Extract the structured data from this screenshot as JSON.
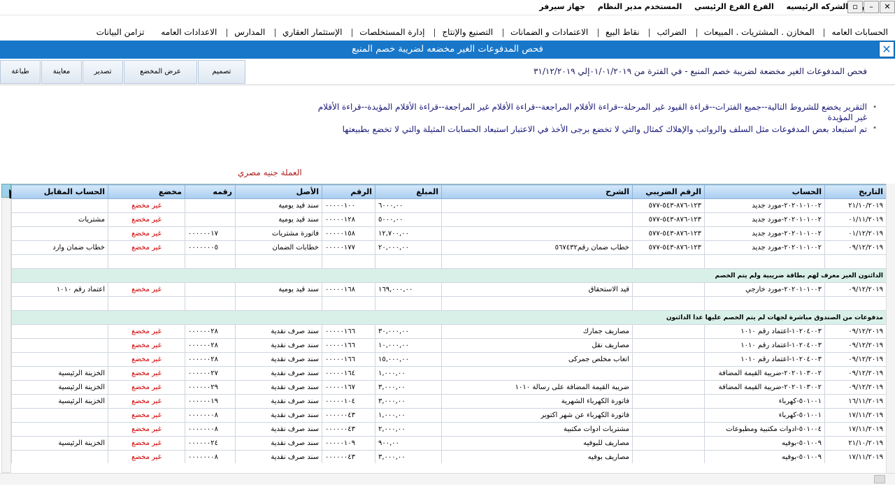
{
  "titlebar": {
    "company": "الشركة الشركه الرئيسيه",
    "branch": "الفرع الفرع الرئيسي",
    "user": "المستخدم مدير النظام",
    "device": "جهاز سيرفر",
    "buttons": [
      "▫",
      "–",
      "✕"
    ]
  },
  "menu": [
    "الحسابات العامه",
    "المخازن . المشتريات . المبيعات",
    "الضرائب",
    "نقاط البيع",
    "الاعتمادات و الضمانات",
    "التصنيع والإنتاج",
    "إدارة المستخلصات",
    "الإستثمار العقاري",
    "المدارس",
    "الاعدادات العامه",
    "تزامن البيانات"
  ],
  "form": {
    "title": "فحص المدفوعات الغير مخضعه لضريبة خصم المنبع",
    "close": "✕"
  },
  "toolbar": [
    "تصميم",
    "عرض المخضع",
    "تصدير",
    "معاينة",
    "طباعة"
  ],
  "report_title": "فحص المدفوعات الغير مخضعة لضريبة خصم المنبع -    في الفترة من ٠١/٠١/٢٠١٩إلي ٣١/١٢/٢٠١٩",
  "notes": [
    "التقرير يخضع للشروط التالية--جميع الفترات--قراءة القيود غير المرحلة--قراءة الأقلام المراجعة--قراءة الأقلام غير المراجعة--قراءة الأقلام المؤيدة--قراءة الأقلام غير المؤيدة",
    "تم استبعاد بعض المدفوعات مثل السلف والرواتب والإهلاك كمثال والتي لا تخضع برجى الأخذ في الاعتبار استبعاد الحسابات المثيلة والتي لا تخضع بطبيعتها"
  ],
  "currency": "العملة جنيه مصري",
  "grid": {
    "columns": [
      "التاريخ",
      "الحساب",
      "الرقم الضريبي",
      "الشرح",
      "المبلغ",
      "الرقم",
      "الأصل",
      "رقمه",
      "مخضع",
      "الحساب المقابل"
    ],
    "rows": [
      {
        "type": "row",
        "cells": [
          "٢١/١٠/٢٠١٩",
          "٢٠٢٠١٠١٠٠٢-مورد جديد",
          "١٢٣-٨٧٦-٥٤٣-٥٧٧",
          "",
          "٦٠٠٠,٠٠",
          "٠٠٠٠٠١٠٠",
          "سند قيد يومية",
          "",
          "غير مخضع",
          ""
        ]
      },
      {
        "type": "row",
        "cells": [
          "٠١/١١/٢٠١٩",
          "٢٠٢٠١٠١٠٠٢-مورد جديد",
          "١٢٣-٨٧٦-٥٤٣-٥٧٧",
          "",
          "٥٠٠٠,٠٠",
          "٠٠٠٠٠١٢٨",
          "سند قيد يومية",
          "",
          "غير مخضع",
          "مشتريات"
        ]
      },
      {
        "type": "row",
        "cells": [
          "٠١/١٢/٢٠١٩",
          "٢٠٢٠١٠١٠٠٢-مورد جديد",
          "١٢٣-٨٧٦-٥٤٣-٥٧٧",
          "",
          "١٢,٧٠٠,٠٠",
          "٠٠٠٠٠١٥٨",
          "فاتورة مشتريات",
          "٠٠٠٠٠٠١٧",
          "غير مخضع",
          ""
        ]
      },
      {
        "type": "row",
        "cells": [
          "٠٩/١٢/٢٠١٩",
          "٢٠٢٠١٠١٠٠٢-مورد جديد",
          "١٢٣-٨٧٦-٥٤٣-٥٧٧",
          "خطاب ضمان رقم٥٦٧٤٣٢",
          "٢٠,٠٠٠,٠٠",
          "٠٠٠٠٠١٧٧",
          "خطابات الضمان",
          "٠٠٠٠٠٠٠٥",
          "غير مخضع",
          "خطاب ضمان وارد"
        ]
      },
      {
        "type": "empty"
      },
      {
        "type": "group",
        "label": "الدائنون الغير معرف لهم بطاقة ضريبية ولم يتم الخصم"
      },
      {
        "type": "row",
        "cells": [
          "٠٩/١٢/٢٠١٩",
          "٢٠٢٠١٠١٠٠٣-مورد خارجي",
          "",
          "قيد الاستحقاق",
          "١٦٩,٠٠٠,٠٠",
          "٠٠٠٠٠١٦٨",
          "سند قيد يومية",
          "",
          "غير مخضع",
          "اعتماد رقم ١٠١٠"
        ]
      },
      {
        "type": "empty"
      },
      {
        "type": "group",
        "label": "مدفوعات من الصندوق مباشرة لجهات لم يتم الخصم عليها عدا الدائنون"
      },
      {
        "type": "row",
        "cells": [
          "٠٩/١٢/٢٠١٩",
          "١٠٢٠٤٠٠٣-اعتماد رقم ١٠١٠",
          "",
          "مصاريف جمارك",
          "٣٠,٠٠٠,٠٠",
          "٠٠٠٠٠١٦٦",
          "سند صرف نقدية",
          "٠٠٠٠٠٠٢٨",
          "غير مخضع",
          ""
        ]
      },
      {
        "type": "row",
        "cells": [
          "٠٩/١٢/٢٠١٩",
          "١٠٢٠٤٠٠٣-اعتماد رقم ١٠١٠",
          "",
          "مصاريف نقل",
          "١٠,٠٠٠,٠٠",
          "٠٠٠٠٠١٦٦",
          "سند صرف نقدية",
          "٠٠٠٠٠٠٢٨",
          "غير مخضع",
          ""
        ]
      },
      {
        "type": "row",
        "cells": [
          "٠٩/١٢/٢٠١٩",
          "١٠٢٠٤٠٠٣-اعتماد رقم ١٠١٠",
          "",
          "اتعاب مخلص جمركى",
          "١٥,٠٠٠,٠٠",
          "٠٠٠٠٠١٦٦",
          "سند صرف نقدية",
          "٠٠٠٠٠٠٢٨",
          "غير مخضع",
          ""
        ]
      },
      {
        "type": "row",
        "cells": [
          "٠٩/١٢/٢٠١٩",
          "٢٠٢٠١٠٣٠٠٢-ضريبة القيمة المضافة",
          "",
          "",
          "١,٠٠٠,٠٠",
          "٠٠٠٠٠١٦٤",
          "سند صرف نقدية",
          "٠٠٠٠٠٠٢٧",
          "غير مخضع",
          "الخزينة الرئيسية"
        ]
      },
      {
        "type": "row",
        "cells": [
          "٠٩/١٢/٢٠١٩",
          "٢٠٢٠١٠٣٠٠٢-ضريبة القيمة المضافة",
          "",
          "ضريبة القيمة المضافة على رسالة ١٠١٠",
          "٣,٠٠٠,٠٠",
          "٠٠٠٠٠١٦٧",
          "سند صرف نقدية",
          "٠٠٠٠٠٠٢٩",
          "غير مخضع",
          "الخزينة الرئيسية"
        ]
      },
      {
        "type": "row",
        "cells": [
          "١٦/١١/٢٠١٩",
          "٥٠١٠٠١-كهرباء",
          "",
          "فاتورة الكهرباء الشهرية",
          "٣,٠٠٠,٠٠",
          "٠٠٠٠٠١٠٤",
          "سند صرف نقدية",
          "٠٠٠٠٠٠١٩",
          "غير مخضع",
          "الخزينة الرئيسية"
        ]
      },
      {
        "type": "row",
        "cells": [
          "١٧/١١/٢٠١٩",
          "٥٠١٠٠١-كهرباء",
          "",
          "فاتورة الكهرباء عن شهر اكتوبر",
          "١,٠٠٠,٠٠",
          "٠٠٠٠٠٠٤٣",
          "سند صرف نقدية",
          "٠٠٠٠٠٠٠٨",
          "غير مخضع",
          ""
        ]
      },
      {
        "type": "row",
        "cells": [
          "١٧/١١/٢٠١٩",
          "٥٠١٠٠٤-ادوات مكتبية ومطبوعات",
          "",
          "مشتريات ادوات مكتبية",
          "٢,٠٠٠,٠٠",
          "٠٠٠٠٠٠٤٣",
          "سند صرف نقدية",
          "٠٠٠٠٠٠٠٨",
          "غير مخضع",
          ""
        ]
      },
      {
        "type": "row",
        "cells": [
          "٢١/١٠/٢٠١٩",
          "٥٠١٠٠٩-بوفيه",
          "",
          "مصاريف للبوفيه",
          "٩٠٠,٠٠",
          "٠٠٠٠٠١٠٩",
          "سند صرف نقدية",
          "٠٠٠٠٠٠٢٤",
          "غير مخضع",
          "الخزينة الرئيسية"
        ]
      },
      {
        "type": "row",
        "cells": [
          "١٧/١١/٢٠١٩",
          "٥٠١٠٠٩-بوفيه",
          "",
          "مصاريف بوفيه",
          "٣,٠٠٠,٠٠",
          "٠٠٠٠٠٠٤٣",
          "سند صرف نقدية",
          "٠٠٠٠٠٠٠٨",
          "غير مخضع",
          ""
        ]
      }
    ]
  }
}
